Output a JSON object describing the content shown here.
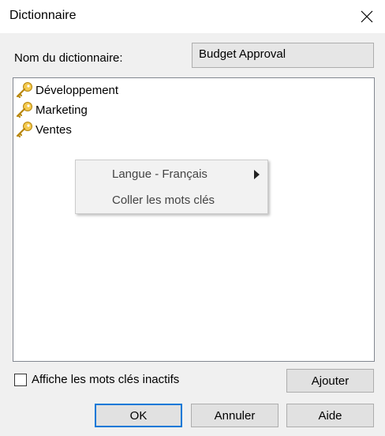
{
  "window": {
    "title": "Dictionnaire",
    "close_icon": "close-icon"
  },
  "form": {
    "dict_name_label": "Nom du dictionnaire:",
    "dict_name_value": "Budget Approval"
  },
  "tree": {
    "items": [
      {
        "label": "Développement",
        "icon": "key-icon"
      },
      {
        "label": "Marketing",
        "icon": "key-icon"
      },
      {
        "label": "Ventes",
        "icon": "key-icon"
      }
    ]
  },
  "context_menu": {
    "items": [
      {
        "label": "Langue - Français",
        "has_submenu": true
      },
      {
        "label": "Coller les mots clés",
        "has_submenu": false
      }
    ]
  },
  "options": {
    "show_inactive_label": "Affiche les mots clés inactifs",
    "show_inactive_checked": false
  },
  "buttons": {
    "add": "Ajouter",
    "ok": "OK",
    "cancel": "Annuler",
    "help": "Aide"
  },
  "colors": {
    "dialog_bg": "#f0f0f0",
    "accent_focus": "#0078d7",
    "key_gold": "#e2b13c"
  }
}
